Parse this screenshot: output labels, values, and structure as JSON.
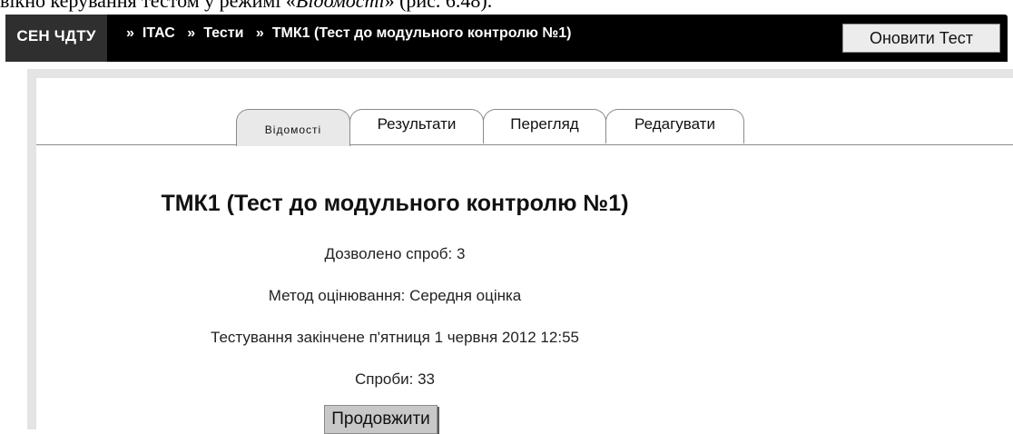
{
  "document_text": {
    "prefix": "вікно керування тестом у режимі «",
    "mode": "Відомості",
    "suffix": "» (рис. 6.48)."
  },
  "navbar": {
    "home": "СЕН ЧДТУ",
    "breadcrumb": [
      {
        "sep": "»",
        "label": "ІТАС"
      },
      {
        "sep": "»",
        "label": "Тести"
      },
      {
        "sep": "»",
        "label": "ТМК1 (Тест до модульного контролю №1)"
      }
    ],
    "update_button": "Оновити Тест"
  },
  "tabs": [
    {
      "label": "Відомості",
      "active": true
    },
    {
      "label": "Результати",
      "active": false
    },
    {
      "label": "Перегляд",
      "active": false
    },
    {
      "label": "Редагувати",
      "active": false
    }
  ],
  "quiz": {
    "title": "ТМК1 (Тест до модульного контролю №1)",
    "attempts_allowed": "Дозволено спроб: 3",
    "grading_method": "Метод оцінювання: Середня оцінка",
    "closed": "Тестування закінчене п'ятниця 1 червня 2012 12:55",
    "attempts": "Спроби: 33",
    "continue_button": "Продовжити"
  }
}
